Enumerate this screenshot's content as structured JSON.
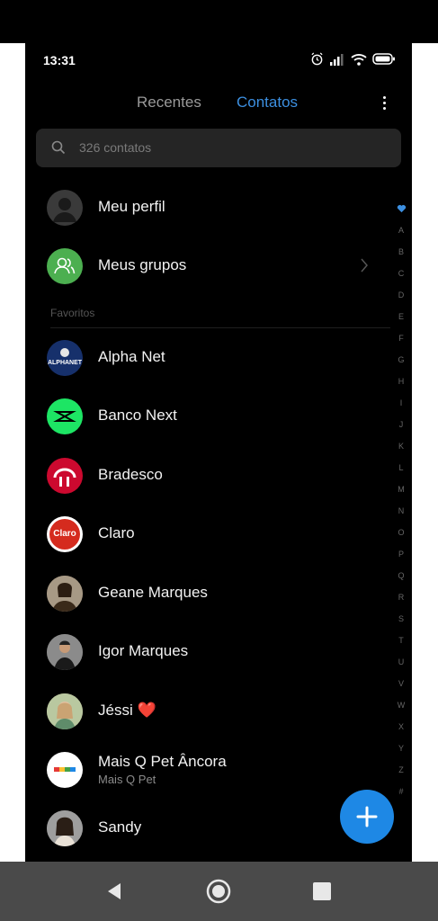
{
  "status": {
    "time": "13:31",
    "icons": [
      "alarm-icon",
      "signal-icon",
      "wifi-icon",
      "battery-icon"
    ]
  },
  "tabs": [
    {
      "label": "Recentes",
      "active": false
    },
    {
      "label": "Contatos",
      "active": true
    }
  ],
  "search": {
    "placeholder": "326 contatos"
  },
  "top_items": [
    {
      "name": "Meu perfil",
      "icon": "profile-silhouette-icon"
    },
    {
      "name": "Meus grupos",
      "icon": "groups-icon"
    }
  ],
  "section_label": "Favoritos",
  "contacts": [
    {
      "name": "Alpha Net",
      "avatar": "alphanet-logo",
      "logo_text": "ALPHANET"
    },
    {
      "name": "Banco Next",
      "avatar": "banco-next-logo"
    },
    {
      "name": "Bradesco",
      "avatar": "bradesco-logo"
    },
    {
      "name": "Claro",
      "avatar": "claro-logo",
      "logo_text": "Claro"
    },
    {
      "name": "Geane Marques",
      "avatar": "person-photo"
    },
    {
      "name": "Igor Marques",
      "avatar": "person-photo"
    },
    {
      "name": "Jéssi",
      "heart": "❤️",
      "avatar": "person-photo"
    },
    {
      "name": "Mais Q Pet Âncora",
      "subtitle": "Mais Q Pet",
      "avatar": "maisqpet-logo"
    },
    {
      "name": "Sandy",
      "avatar": "person-photo"
    }
  ],
  "index_letters": [
    "A",
    "B",
    "C",
    "D",
    "E",
    "F",
    "G",
    "H",
    "I",
    "J",
    "K",
    "L",
    "M",
    "N",
    "O",
    "P",
    "Q",
    "R",
    "S",
    "T",
    "U",
    "V",
    "W",
    "X",
    "Y",
    "Z",
    "#"
  ],
  "colors": {
    "accent": "#3c8fe0",
    "fab": "#1e88e5",
    "groups": "#4caf50",
    "banco_next": "#1de564",
    "bradesco": "#cc092f",
    "claro": "#d52b1e"
  }
}
